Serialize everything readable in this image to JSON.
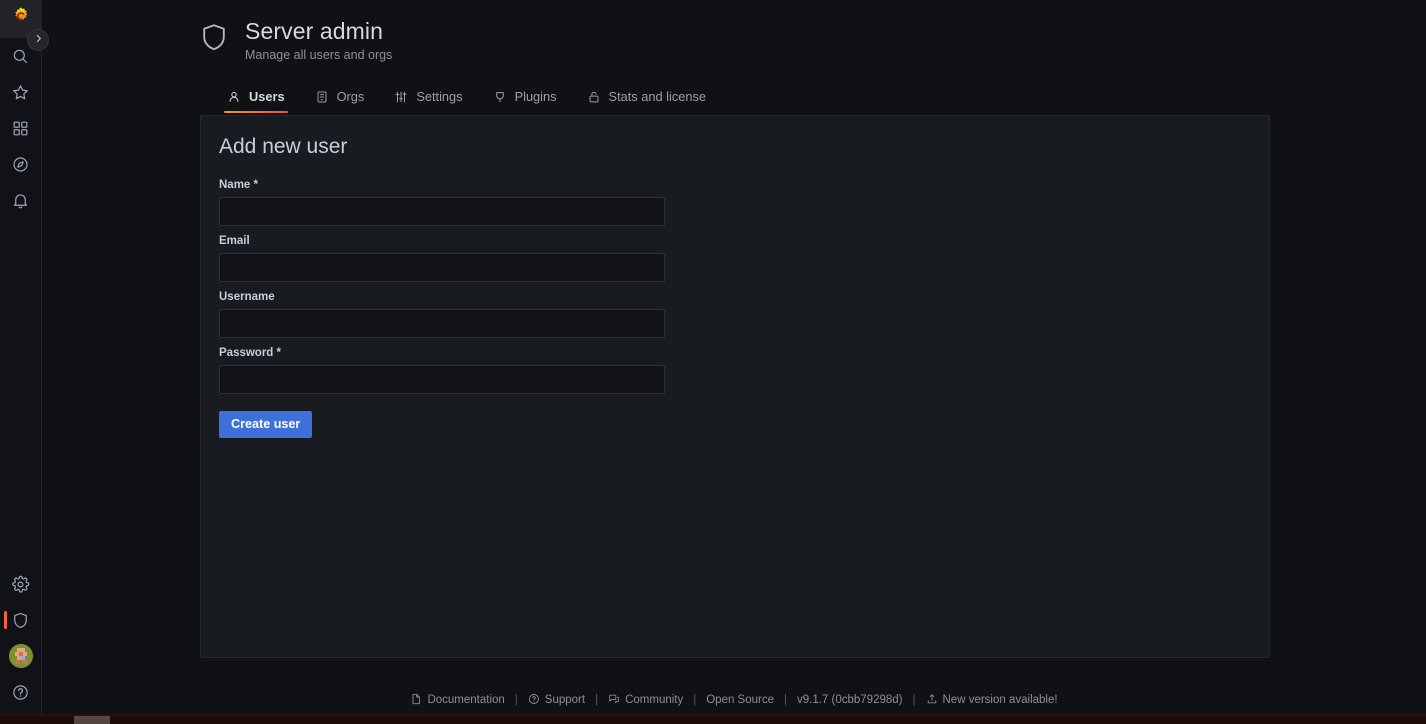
{
  "nav": {
    "logo_icon": "grafana-logo-icon",
    "expand_icon": "chevron-right-icon",
    "top_items": [
      {
        "name": "search",
        "icon": "search-icon",
        "label": "Search"
      },
      {
        "name": "starred",
        "icon": "star-icon",
        "label": "Starred"
      },
      {
        "name": "dashboards",
        "icon": "apps-grid-icon",
        "label": "Dashboards"
      },
      {
        "name": "explore",
        "icon": "compass-icon",
        "label": "Explore"
      },
      {
        "name": "alerting",
        "icon": "bell-icon",
        "label": "Alerting"
      }
    ],
    "bottom_items": [
      {
        "name": "configuration",
        "icon": "gear-icon",
        "label": "Configuration",
        "active": false
      },
      {
        "name": "server-admin",
        "icon": "shield-icon",
        "label": "Server Admin",
        "active": true
      },
      {
        "name": "profile",
        "icon": "avatar",
        "label": "Profile",
        "active": false
      },
      {
        "name": "help",
        "icon": "question-circle-icon",
        "label": "Help",
        "active": false
      }
    ]
  },
  "header": {
    "icon": "shield-icon",
    "title": "Server admin",
    "subtitle": "Manage all users and orgs"
  },
  "tabs": [
    {
      "label": "Users",
      "icon": "user-icon",
      "active": true
    },
    {
      "label": "Orgs",
      "icon": "building-icon",
      "active": false
    },
    {
      "label": "Settings",
      "icon": "sliders-icon",
      "active": false
    },
    {
      "label": "Plugins",
      "icon": "plug-icon",
      "active": false
    },
    {
      "label": "Stats and license",
      "icon": "lock-icon",
      "active": false
    }
  ],
  "form": {
    "heading": "Add new user",
    "fields": [
      {
        "label": "Name *",
        "value": "",
        "placeholder": "",
        "type": "text",
        "name": "name"
      },
      {
        "label": "Email",
        "value": "",
        "placeholder": "",
        "type": "text",
        "name": "email"
      },
      {
        "label": "Username",
        "value": "",
        "placeholder": "",
        "type": "text",
        "name": "username"
      },
      {
        "label": "Password *",
        "value": "",
        "placeholder": "",
        "type": "password",
        "name": "password"
      }
    ],
    "submit_label": "Create user"
  },
  "footer": {
    "separator": "|",
    "items": [
      {
        "label": "Documentation",
        "icon": "document-icon"
      },
      {
        "label": "Support",
        "icon": "question-circle-icon"
      },
      {
        "label": "Community",
        "icon": "comments-icon"
      },
      {
        "label": "Open Source",
        "icon": ""
      },
      {
        "label": "v9.1.7 (0cbb79298d)",
        "icon": ""
      },
      {
        "label": "New version available!",
        "icon": "download-arrow-icon"
      }
    ]
  },
  "colors": {
    "accent_orange": "#f55f3e",
    "primary_blue": "#3d71d9",
    "panel_bg": "#181b1f",
    "page_bg": "#0f1114",
    "nav_bg": "#111217",
    "text_primary": "#ccccdc",
    "text_secondary": "#8e9297"
  }
}
